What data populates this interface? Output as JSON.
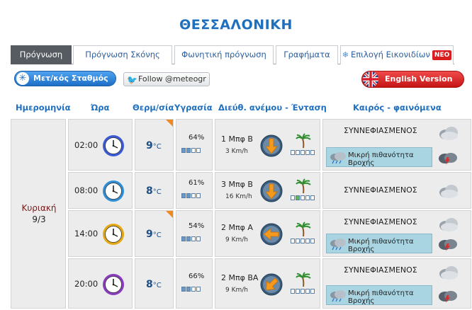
{
  "city": "ΘΕΣΣΑΛΟΝΙΚΗ",
  "tabs": [
    {
      "label": "Πρόγνωση",
      "active": true
    },
    {
      "label": "Πρόγνωση Σκόνης",
      "active": false
    },
    {
      "label": "Φωνητική πρόγνωση",
      "active": false
    },
    {
      "label": "Γραφήματα",
      "active": false
    },
    {
      "label": "Επιλογή Εικονιδίων",
      "active": false,
      "badge": "NEO"
    }
  ],
  "buttons": {
    "stations": "Μετ/κός Σταθμός",
    "follow": "Follow @meteogr",
    "english": "English Version"
  },
  "headers": {
    "date": "Ημερομηνία",
    "time": "Ώρα",
    "temp": "Θερμ/σία",
    "humidity": "Υγρασία",
    "wind": "Διεύθ. ανέμου - Ένταση",
    "weather": "Καιρός - φαινόμενα"
  },
  "day": {
    "name": "Κυριακή",
    "date": "9/3"
  },
  "temp_unit": "°C",
  "rows": [
    {
      "time": "02:00",
      "clock_color": "#3b5bd6",
      "temp": "9",
      "warm": true,
      "humidity": "64%",
      "hum_level": 2,
      "wind": "1 Μπφ Β",
      "speed": "3 Km/h",
      "arrow": "down",
      "wind_level": 0,
      "cond": "ΣΥΝΝΕΦΙΑΣΜΕΝΟΣ",
      "rain": "Μικρή πιθανότητα Βροχής",
      "has_rain": true
    },
    {
      "time": "08:00",
      "clock_color": "#2e8fd8",
      "temp": "8",
      "warm": false,
      "humidity": "61%",
      "hum_level": 2,
      "wind": "3 Μπφ Β",
      "speed": "16 Km/h",
      "arrow": "down",
      "wind_level": 1,
      "cond": "ΣΥΝΝΕΦΙΑΣΜΕΝΟΣ",
      "rain": "",
      "has_rain": false
    },
    {
      "time": "14:00",
      "clock_color": "#e3a814",
      "temp": "9",
      "warm": true,
      "humidity": "54%",
      "hum_level": 2,
      "wind": "2 Μπφ Α",
      "speed": "9 Km/h",
      "arrow": "left",
      "wind_level": 0,
      "cond": "ΣΥΝΝΕΦΙΑΣΜΕΝΟΣ",
      "rain": "Μικρή πιθανότητα Βροχής",
      "has_rain": true
    },
    {
      "time": "20:00",
      "clock_color": "#8a3bbf",
      "temp": "8",
      "warm": false,
      "humidity": "66%",
      "hum_level": 2,
      "wind": "2 Μπφ ΒΑ",
      "speed": "9 Km/h",
      "arrow": "downleft",
      "wind_level": 0,
      "cond": "ΣΥΝΝΕΦΙΑΣΜΕΝΟΣ",
      "rain": "Μικρή πιθανότητα Βροχής",
      "has_rain": true
    }
  ]
}
